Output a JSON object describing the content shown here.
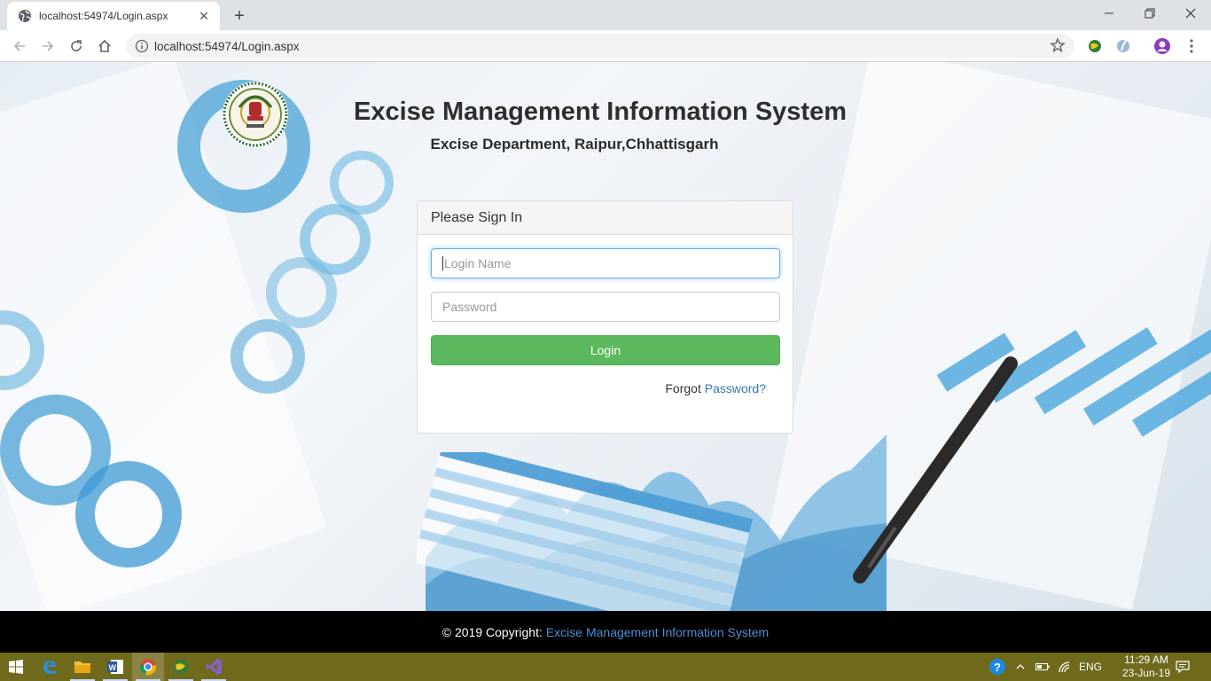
{
  "browser": {
    "tab_title": "localhost:54974/Login.aspx",
    "url": "localhost:54974/Login.aspx",
    "close_tab_glyph": "✕",
    "new_tab_glyph": "+",
    "minimize_glyph": "—",
    "restore_glyph": "❐",
    "close_window_glyph": "✕"
  },
  "header": {
    "title": "Excise Management Information System",
    "subtitle": "Excise Department, Raipur,Chhattisgarh",
    "logo_icon": "state-emblem-icon"
  },
  "login_panel": {
    "heading": "Please Sign In",
    "login_name_placeholder": "Login Name",
    "password_placeholder": "Password",
    "login_button": "Login",
    "forgot_prefix": "Forgot",
    "forgot_link": "Password?"
  },
  "footer": {
    "copyright": "© 2019 Copyright:",
    "link": "Excise Management Information System"
  },
  "taskbar": {
    "language": "ENG",
    "time": "11:29 AM",
    "date": "23-Jun-19"
  },
  "colors": {
    "login_button": "#5cb85c",
    "link": "#337ab7",
    "footer_bg": "#000000",
    "taskbar_bg": "#6f6a1c"
  }
}
